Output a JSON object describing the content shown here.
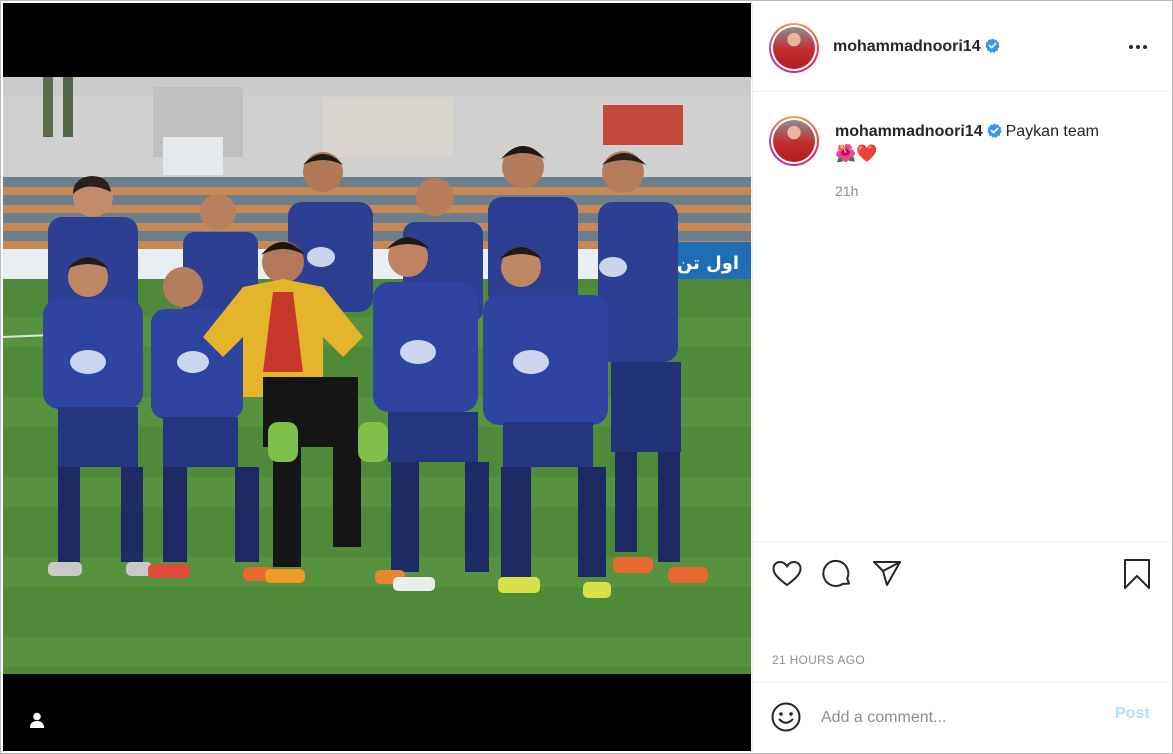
{
  "post": {
    "username": "mohammadnoori14",
    "verified": true,
    "caption": "Paykan team",
    "caption_emojis": "🌺❤️",
    "time_short": "21h",
    "time_full": "21 HOURS AGO"
  },
  "comment": {
    "placeholder": "Add a comment...",
    "post_label": "Post"
  },
  "icons": {
    "more": "more-options-icon",
    "like": "heart-icon",
    "comment": "comment-bubble-icon",
    "share": "paper-plane-icon",
    "save": "bookmark-icon",
    "emoji": "smiley-icon",
    "tagged_user": "user-tag-icon",
    "verified": "verified-badge-icon"
  },
  "colors": {
    "verified_blue": "#3897f0",
    "post_button_disabled": "#b2dffc",
    "muted_text": "#8e8e8e"
  },
  "photo": {
    "subject": "team-photo",
    "billboard_text": "اول تن"
  }
}
